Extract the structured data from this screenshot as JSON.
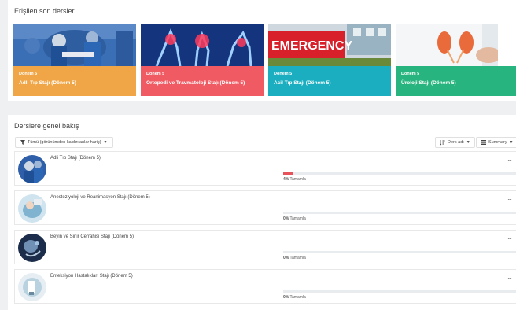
{
  "recent": {
    "title": "Erişilen son dersler",
    "cards": [
      {
        "term": "Dönem 5",
        "name": "Adli Tıp Stajı (Dönem 5)",
        "color": "#f0a646",
        "image": "surgeons-photo"
      },
      {
        "term": "Dönem 5",
        "name": "Ortopedi ve Travmatoloji Stajı (Dönem 5)",
        "color": "#ef5a63",
        "image": "xray-skeleton-photo"
      },
      {
        "term": "Dönem 5",
        "name": "Acil Tıp Stajı (Dönem 5)",
        "color": "#1aaec0",
        "image": "emergency-sign-photo"
      },
      {
        "term": "Dönem 5",
        "name": "Üroloji Stajı (Dönem 5)",
        "color": "#28b47e",
        "image": "kidney-photo"
      }
    ],
    "emergency_sign_text": "EMERGENCY"
  },
  "overview": {
    "title": "Derslere genel bakış",
    "filter_label": "Tümü (görünümden kaldırılanlar hariç)",
    "sort_label": "Ders adı",
    "view_label": "Summary",
    "more_label": "···",
    "courses": [
      {
        "name": "Adli Tıp Stajı (Dönem 5)",
        "progress": 4,
        "progress_text": "4%",
        "complete_label": "Tamamla"
      },
      {
        "name": "Anesteziyoloji ve Reanimasyon Stajı (Dönem 5)",
        "progress": 0,
        "progress_text": "0%",
        "complete_label": "Tamamla"
      },
      {
        "name": "Beyin ve Sinir Cerrahisi Stajı (Dönem 5)",
        "progress": 0,
        "progress_text": "0%",
        "complete_label": "Tamamla"
      },
      {
        "name": "Enfeksiyon Hastalıkları Stajı (Dönem 5)",
        "progress": 0,
        "progress_text": "0%",
        "complete_label": "Tamamla"
      }
    ]
  },
  "colors": {
    "progress_fill": "#e8525a",
    "progress_track": "#e9ecef"
  }
}
